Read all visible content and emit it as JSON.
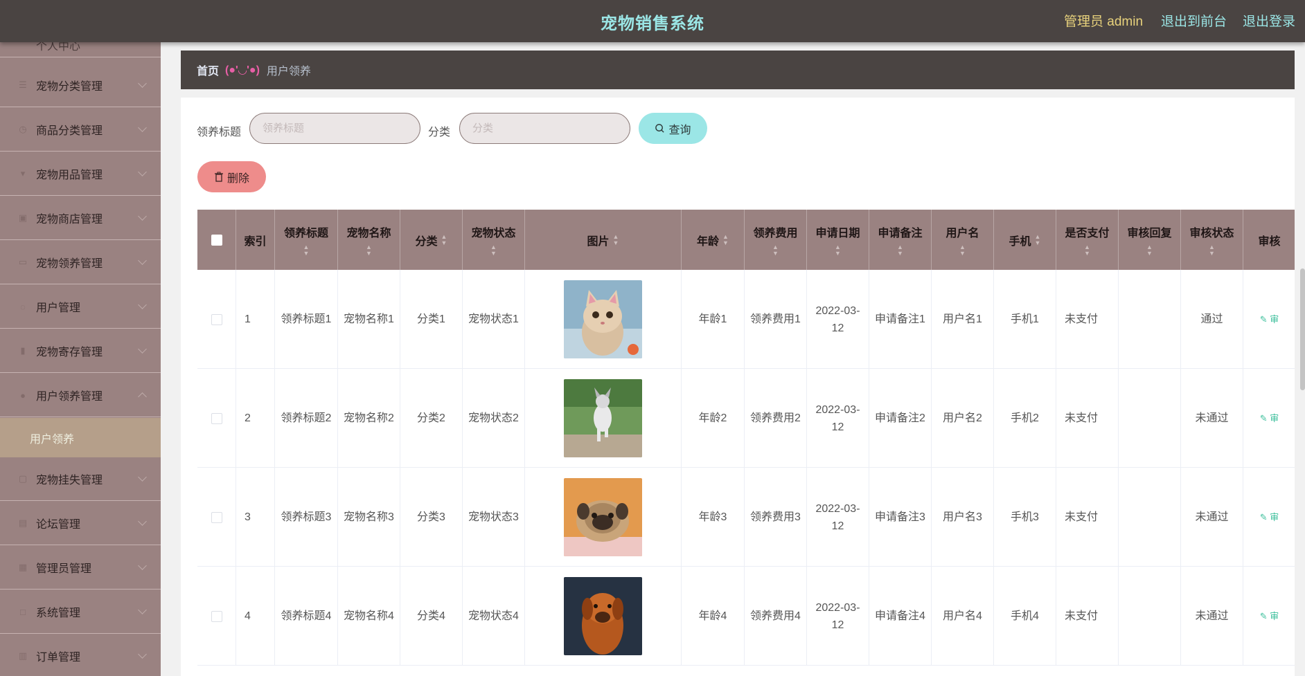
{
  "header": {
    "title": "宠物销售系统",
    "admin_label": "管理员 admin",
    "front_label": "退出到前台",
    "logout_label": "退出登录"
  },
  "sidebar": {
    "partial_item": "个人中心",
    "items": [
      {
        "label": "宠物分类管理",
        "icon": "list-icon"
      },
      {
        "label": "商品分类管理",
        "icon": "clock-icon"
      },
      {
        "label": "宠物用品管理",
        "icon": "cup-icon"
      },
      {
        "label": "宠物商店管理",
        "icon": "shop-icon"
      },
      {
        "label": "宠物领养管理",
        "icon": "screen-icon"
      },
      {
        "label": "用户管理",
        "icon": "loading-icon"
      },
      {
        "label": "宠物寄存管理",
        "icon": "bar-chart-icon"
      },
      {
        "label": "用户领养管理",
        "icon": "location-icon"
      },
      {
        "label": "宠物挂失管理",
        "icon": "chat-icon"
      },
      {
        "label": "论坛管理",
        "icon": "clipboard-icon"
      },
      {
        "label": "管理员管理",
        "icon": "grid-icon"
      },
      {
        "label": "系统管理",
        "icon": "square-icon"
      },
      {
        "label": "订单管理",
        "icon": "document-icon"
      }
    ],
    "active_sub": "用户领养"
  },
  "breadcrumb": {
    "home": "首页",
    "face": "(●'◡'●)",
    "current": "用户领养"
  },
  "search": {
    "title_label": "领养标题",
    "title_placeholder": "领养标题",
    "category_label": "分类",
    "category_placeholder": "分类",
    "query_label": "查询",
    "delete_label": "删除"
  },
  "table": {
    "columns": [
      "索引",
      "领养标题",
      "宠物名称",
      "分类",
      "宠物状态",
      "图片",
      "年龄",
      "领养费用",
      "申请日期",
      "申请备注",
      "用户名",
      "手机",
      "是否支付",
      "审核回复",
      "审核状态",
      "审核"
    ],
    "rows": [
      {
        "index": "1",
        "title": "领养标题1",
        "name": "宠物名称1",
        "category": "分类1",
        "status": "宠物状态1",
        "image": "cat-photo",
        "age": "年龄1",
        "fee": "领养费用1",
        "date": "2022-03-12",
        "note": "申请备注1",
        "user": "用户名1",
        "phone": "手机1",
        "paid": "未支付",
        "reply": "",
        "audit": "通过",
        "action": "审"
      },
      {
        "index": "2",
        "title": "领养标题2",
        "name": "宠物名称2",
        "category": "分类2",
        "status": "宠物状态2",
        "image": "running-dog-photo",
        "age": "年龄2",
        "fee": "领养费用2",
        "date": "2022-03-12",
        "note": "申请备注2",
        "user": "用户名2",
        "phone": "手机2",
        "paid": "未支付",
        "reply": "",
        "audit": "未通过",
        "action": "审"
      },
      {
        "index": "3",
        "title": "领养标题3",
        "name": "宠物名称3",
        "category": "分类3",
        "status": "宠物状态3",
        "image": "pug-photo",
        "age": "年龄3",
        "fee": "领养费用3",
        "date": "2022-03-12",
        "note": "申请备注3",
        "user": "用户名3",
        "phone": "手机3",
        "paid": "未支付",
        "reply": "",
        "audit": "未通过",
        "action": "审"
      },
      {
        "index": "4",
        "title": "领养标题4",
        "name": "宠物名称4",
        "category": "分类4",
        "status": "宠物状态4",
        "image": "mastiff-photo",
        "age": "年龄4",
        "fee": "领养费用4",
        "date": "2022-03-12",
        "note": "申请备注4",
        "user": "用户名4",
        "phone": "手机4",
        "paid": "未支付",
        "reply": "",
        "audit": "未通过",
        "action": "审"
      }
    ]
  },
  "colors": {
    "topbar": "#4a4442",
    "title": "#9be6e6",
    "admin": "#e8d27c",
    "sidebar": "#9a8281",
    "active_sub": "#b59f8a",
    "query_button": "#9be6e6",
    "delete_button": "#ee8c8b",
    "action": "#3bbf9b"
  }
}
